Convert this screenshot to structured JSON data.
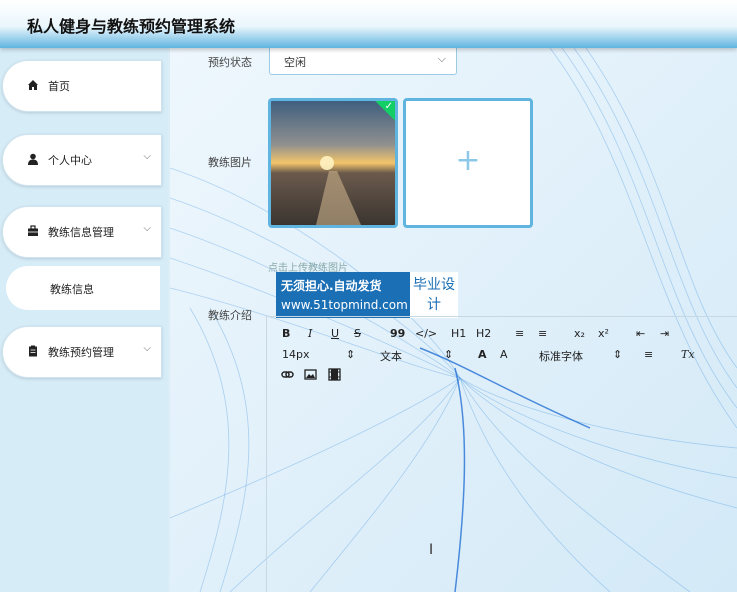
{
  "app": {
    "title": "私人健身与教练预约管理系统"
  },
  "sidebar": {
    "items": [
      {
        "label": "首页",
        "icon": "home-icon",
        "has_arrow": false
      },
      {
        "label": "个人中心",
        "icon": "user-icon",
        "has_arrow": true
      },
      {
        "label": "教练信息管理",
        "icon": "briefcase-icon",
        "has_arrow": true
      },
      {
        "label": "教练信息",
        "icon": "",
        "has_arrow": false
      },
      {
        "label": "教练预约管理",
        "icon": "clipboard-icon",
        "has_arrow": true
      }
    ],
    "arrow_glyph": "⌵"
  },
  "form": {
    "status_label": "预约状态",
    "status_value": "空闲",
    "image_label": "教练图片",
    "upload_hint": "点击上传教练图片",
    "intro_label": "教练介绍"
  },
  "watermark": {
    "line1": "无须担心.自动发货",
    "line2": "www.51topmind.com",
    "badge": "毕业设计"
  },
  "editor": {
    "toolbar_row1": [
      "B",
      "I",
      "U",
      "S",
      "99",
      "</>",
      "H1",
      "H2",
      "≡",
      "≡",
      "x₂",
      "x²",
      "⇤",
      "⇥"
    ],
    "font_size": "14px",
    "text_type": "文本",
    "font_family": "标准字体",
    "toolbar_row2_icons": [
      "A",
      "A"
    ],
    "align_icon": "≡",
    "clear_format": "Tx",
    "toolbar_row3": [
      "link-icon",
      "image-icon",
      "video-icon"
    ]
  },
  "colors": {
    "accent": "#5fb4e0",
    "check": "#13ce66",
    "watermark": "#1b6fb5"
  }
}
